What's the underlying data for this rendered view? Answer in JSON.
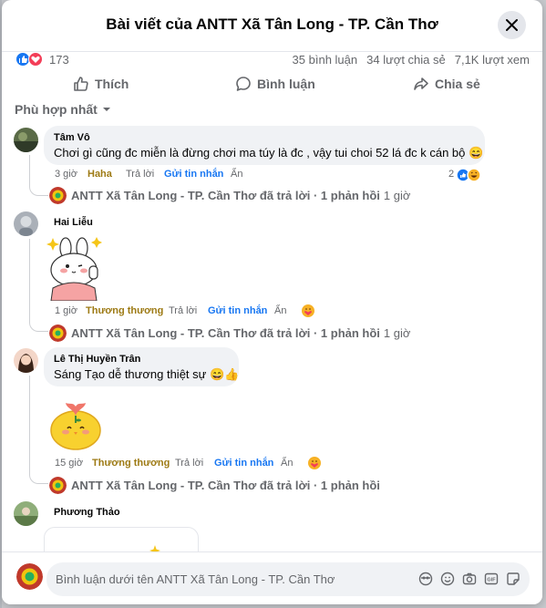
{
  "header": {
    "title": "Bài viết của ANTT Xã Tân Long - TP. Cần Thơ"
  },
  "stats": {
    "reaction_count": "173",
    "comments": "35 bình luận",
    "shares": "34 lượt chia sẻ",
    "views": "7,1K lượt xem"
  },
  "actions": {
    "like": "Thích",
    "comment": "Bình luận",
    "share": "Chia sẻ"
  },
  "sort": {
    "label": "Phù hợp nhất"
  },
  "comments": [
    {
      "name": "Tâm Vô",
      "text": "Chơi gì cũng đc miễn là đừng chơi ma túy là đc , vậy tui choi 52 lá đc k cán bộ 😄",
      "time": "3 giờ",
      "reaction_word": "Haha",
      "reply_label": "Trả lời",
      "message_label": "Gửi tin nhắn",
      "hide_label": "Ẩn",
      "reaction_total": "2",
      "page_reply": "ANTT Xã Tân Long - TP. Cần Thơ đã trả lời · 1 phản hồi",
      "page_reply_time": "1 giờ"
    },
    {
      "name": "Hai Liễu",
      "time": "1 giờ",
      "reaction_word": "Thương thương",
      "reply_label": "Trả lời",
      "message_label": "Gửi tin nhắn",
      "hide_label": "Ẩn",
      "page_reply": "ANTT Xã Tân Long - TP. Cần Thơ đã trả lời · 1 phản hồi",
      "page_reply_time": "1 giờ"
    },
    {
      "name": "Lê Thị Huyền Trân",
      "text": "Sáng Tạo dễ thương thiệt sự 😄👍",
      "time": "15 giờ",
      "reaction_word": "Thương thương",
      "reply_label": "Trả lời",
      "message_label": "Gửi tin nhắn",
      "hide_label": "Ẩn",
      "page_reply": "ANTT Xã Tân Long - TP. Cần Thơ đã trả lời · 1 phản hồi"
    },
    {
      "name": "Phương Thảo"
    }
  ],
  "composer": {
    "placeholder": "Bình luận dưới tên ANTT Xã Tân Long - TP. Cần Thơ"
  },
  "colors": {
    "accent": "#1877f2",
    "reaction_word": "#9d7a14",
    "muted": "#65676b",
    "bubble": "#f0f2f5"
  },
  "icons": [
    "close-icon",
    "like-icon",
    "comment-icon",
    "share-icon",
    "chevron-down-icon",
    "haha-icon",
    "care-icon",
    "emoji-icon",
    "camera-icon",
    "gif-icon",
    "sticker-icon"
  ]
}
